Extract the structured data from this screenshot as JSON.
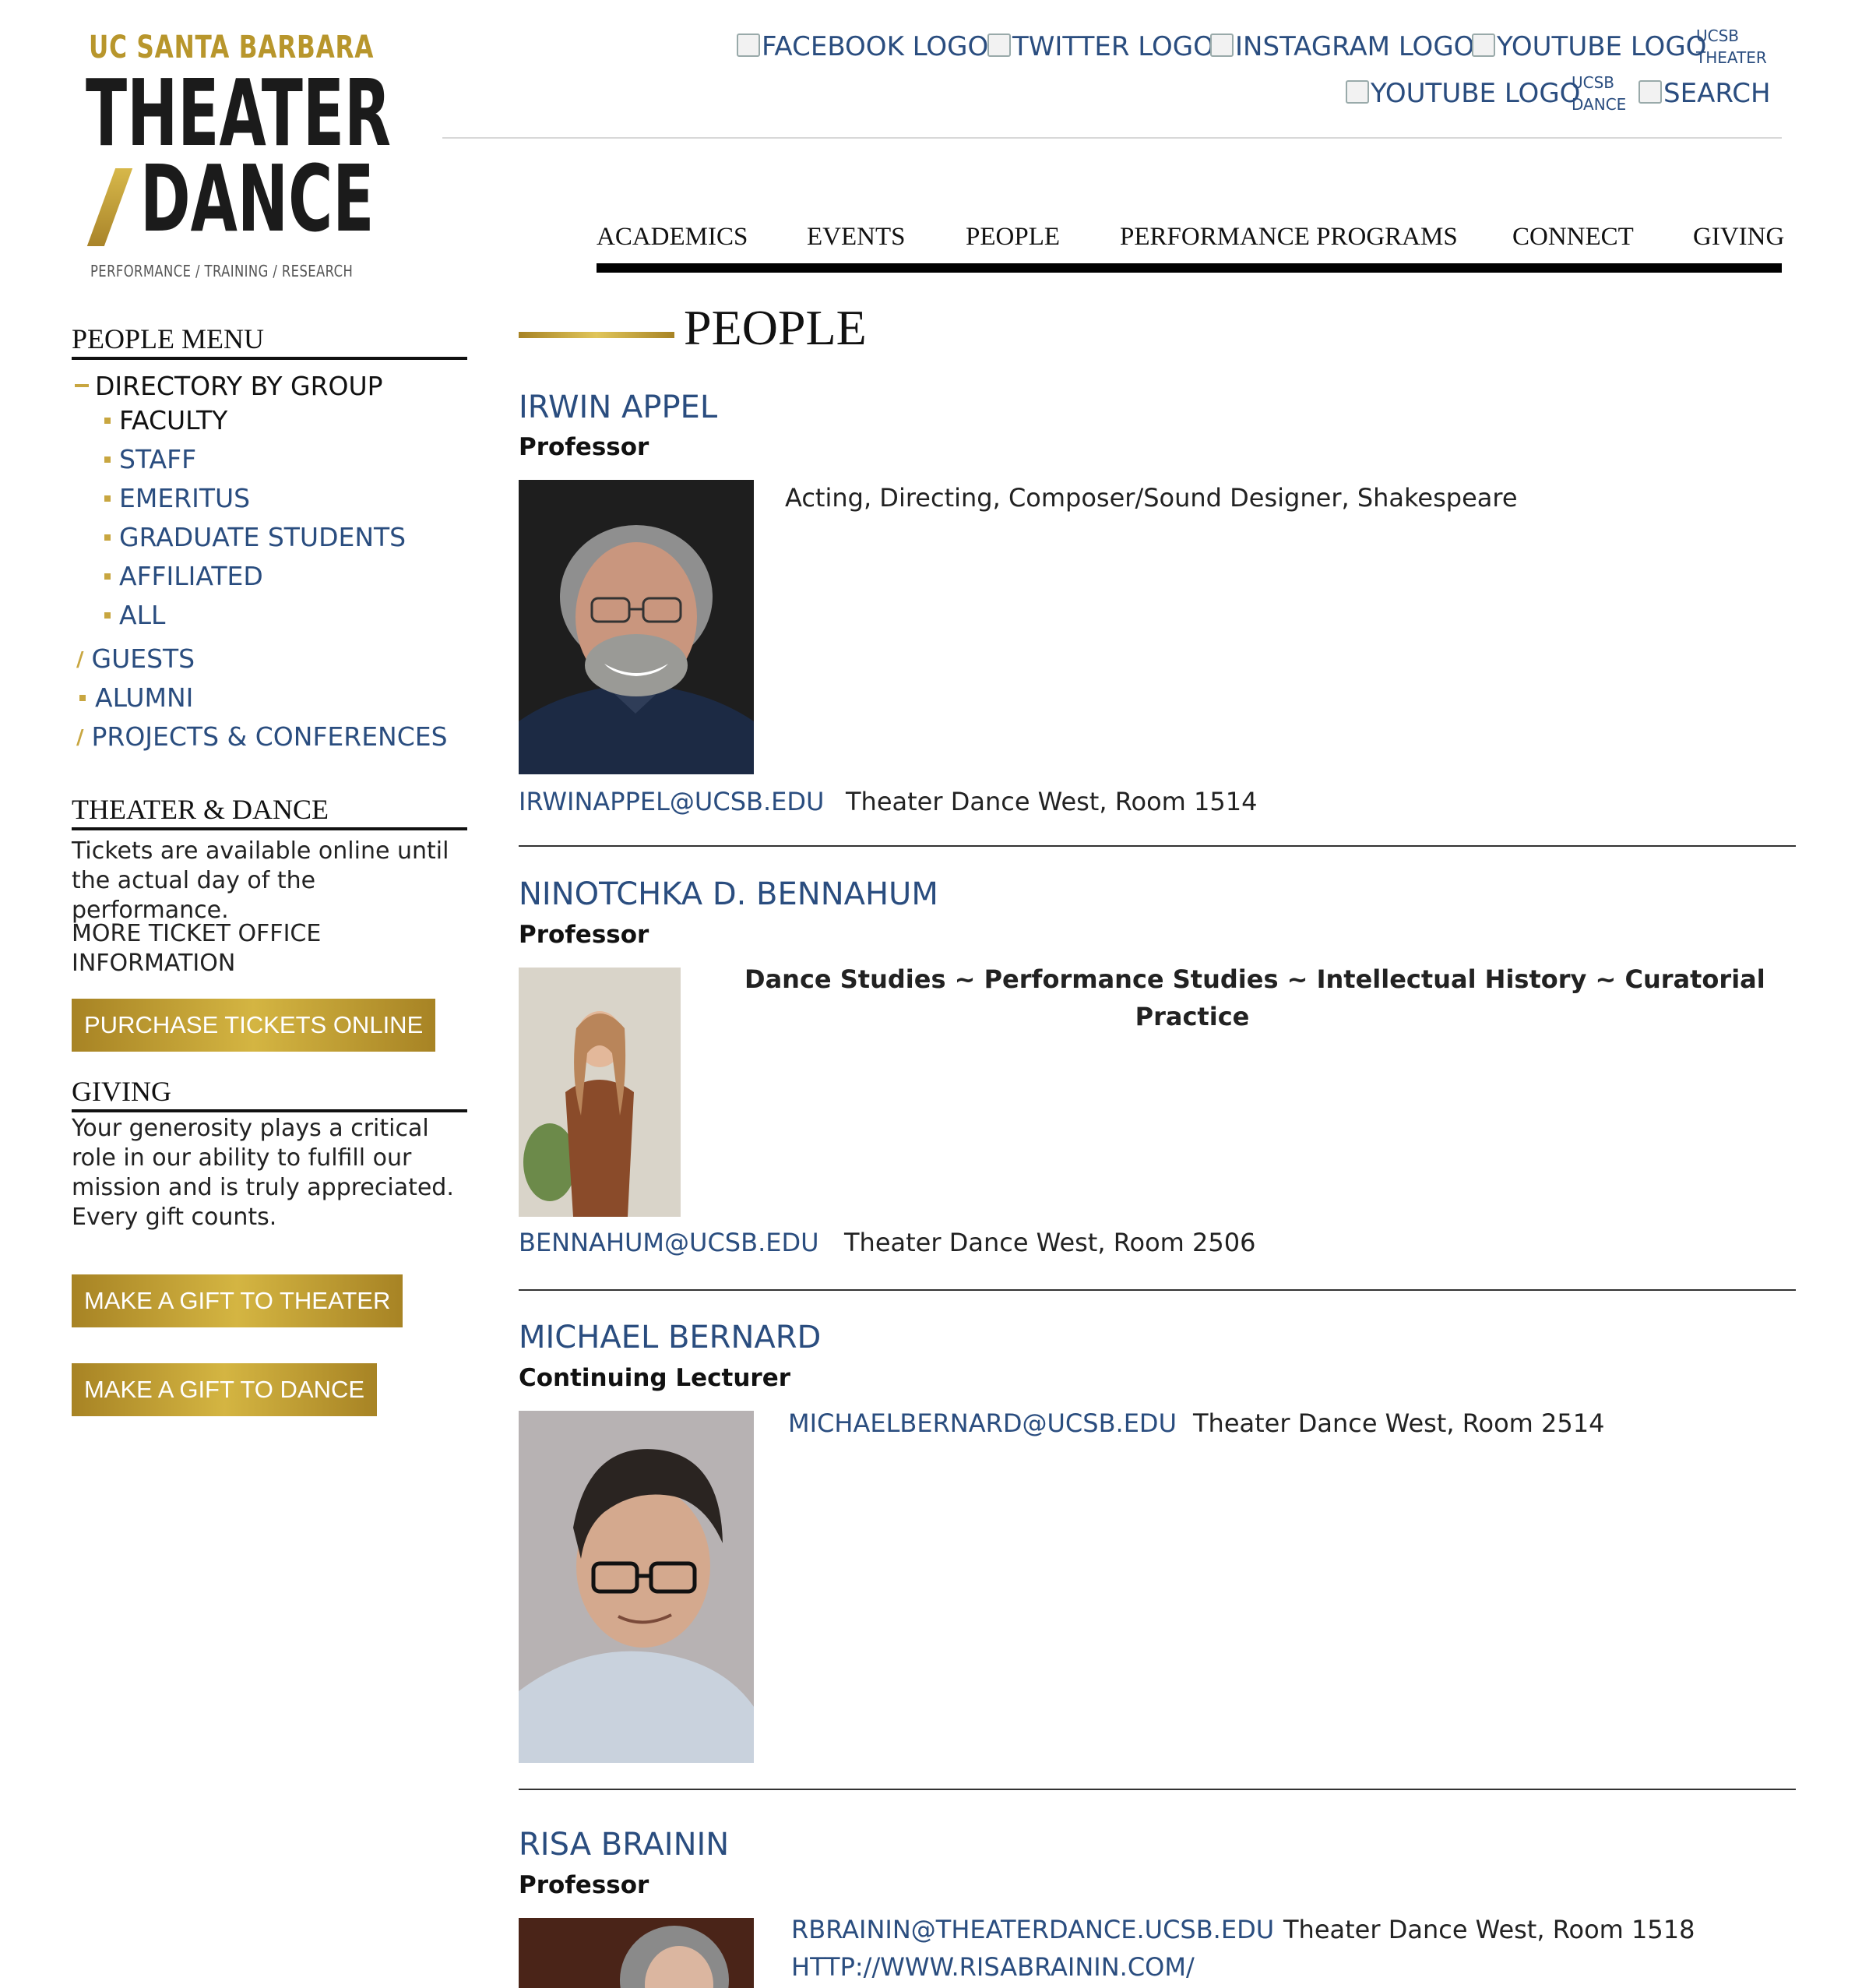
{
  "logo": {
    "line1": "UC SANTA BARBARA",
    "line2": "THEATER",
    "line3": "DANCE",
    "tagline": "PERFORMANCE / TRAINING / RESEARCH"
  },
  "social": {
    "facebook": "FACEBOOK LOGO",
    "twitter": "TWITTER LOGO",
    "instagram": "INSTAGRAM LOGO",
    "youtube_theater": "YOUTUBE LOGO",
    "youtube_theater_sub1": "UCSB",
    "youtube_theater_sub2": "THEATER",
    "youtube_dance": "YOUTUBE LOGO",
    "youtube_dance_sub1": "UCSB",
    "youtube_dance_sub2": "DANCE",
    "search": "SEARCH"
  },
  "nav": {
    "academics": "ACADEMICS",
    "events": "EVENTS",
    "people": "PEOPLE",
    "performance_programs": "PERFORMANCE PROGRAMS",
    "connect": "CONNECT",
    "giving": "GIVING"
  },
  "sidebar": {
    "people_menu_title": "PEOPLE MENU",
    "directory_by_group": "DIRECTORY BY GROUP",
    "sub": {
      "faculty": "FACULTY",
      "staff": "STAFF",
      "emeritus": "EMERITUS",
      "graduate_students": "GRADUATE STUDENTS",
      "affiliated": "AFFILIATED",
      "all": "ALL"
    },
    "guests": "GUESTS",
    "alumni": "ALUMNI",
    "projects": "PROJECTS & CONFERENCES",
    "td_title": "THEATER & DANCE",
    "td_text": "Tickets are available online until the actual day of the performance.",
    "more_ticket_1": "MORE TICKET OFFICE",
    "more_ticket_2": "INFORMATION",
    "purchase": "PURCHASE TICKETS ONLINE",
    "giving_title": "GIVING",
    "giving_text": "Your generosity plays a critical role in our ability to fulfill our mission and is truly appreciated. Every gift counts.",
    "gift_theater": "MAKE A GIFT TO THEATER",
    "gift_dance": "MAKE A GIFT TO DANCE"
  },
  "page_title": "PEOPLE",
  "people": [
    {
      "name": "IRWIN APPEL",
      "role": "Professor",
      "description": "Acting, Directing, Composer/Sound Designer, Shakespeare",
      "email": "IRWINAPPEL@UCSB.EDU",
      "office": "Theater Dance West, Room 1514"
    },
    {
      "name": "NINOTCHKA D. BENNAHUM",
      "role": "Professor",
      "description_1": "Dance Studies ~ Performance Studies ~ Intellectual History ~ Curatorial",
      "description_2": "Practice",
      "email": "BENNAHUM@UCSB.EDU",
      "office": "Theater Dance West, Room 2506"
    },
    {
      "name": "MICHAEL BERNARD",
      "role": "Continuing Lecturer",
      "email": "MICHAELBERNARD@UCSB.EDU",
      "office": "Theater Dance West, Room 2514"
    },
    {
      "name": "RISA BRAININ",
      "role": "Professor",
      "email": "RBRAININ@THEATERDANCE.UCSB.EDU",
      "office": "Theater Dance West, Room 1518",
      "website": "HTTP://WWW.RISABRAININ.COM/"
    }
  ]
}
